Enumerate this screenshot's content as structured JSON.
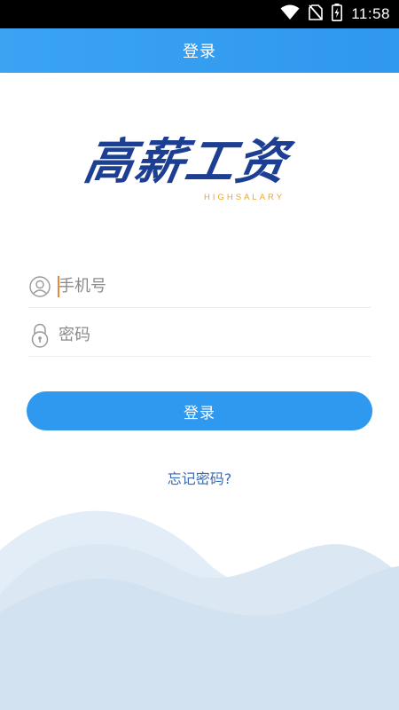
{
  "status_bar": {
    "time": "11:58",
    "icons": [
      "wifi-icon",
      "no-sim-icon",
      "battery-charging-icon"
    ]
  },
  "app_bar": {
    "title": "登录"
  },
  "logo": {
    "text_cn": "高薪工资",
    "text_en": "HIGHSALARY",
    "colors": {
      "primary": "#1c3f93",
      "accent": "#f1a320"
    }
  },
  "form": {
    "phone": {
      "placeholder": "手机号",
      "value": "",
      "icon": "user-icon"
    },
    "password": {
      "placeholder": "密码",
      "value": "",
      "icon": "lock-icon"
    }
  },
  "login_button": {
    "label": "登录"
  },
  "forgot_password": {
    "label": "忘记密码?"
  },
  "colors": {
    "primary": "#2f98ef",
    "link": "#3b6bb3",
    "wave": "#d6e5f3"
  }
}
